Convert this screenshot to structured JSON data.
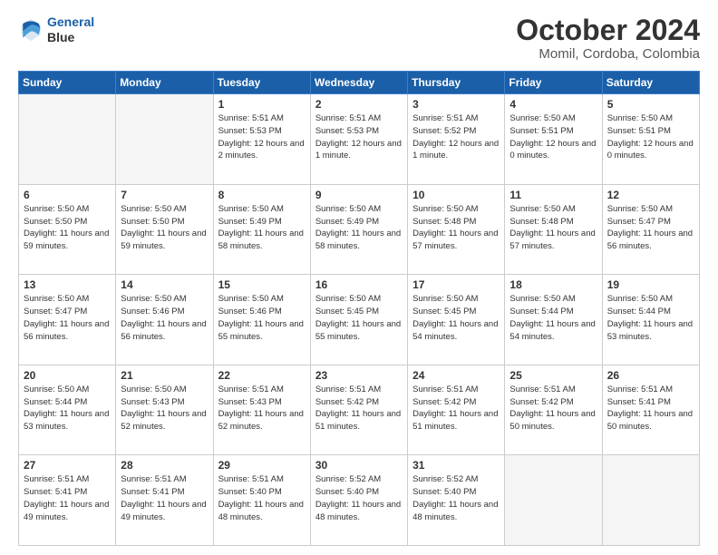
{
  "header": {
    "logo_line1": "General",
    "logo_line2": "Blue",
    "month": "October 2024",
    "location": "Momil, Cordoba, Colombia"
  },
  "weekdays": [
    "Sunday",
    "Monday",
    "Tuesday",
    "Wednesday",
    "Thursday",
    "Friday",
    "Saturday"
  ],
  "weeks": [
    [
      {
        "day": "",
        "sunrise": "",
        "sunset": "",
        "daylight": ""
      },
      {
        "day": "",
        "sunrise": "",
        "sunset": "",
        "daylight": ""
      },
      {
        "day": "1",
        "sunrise": "Sunrise: 5:51 AM",
        "sunset": "Sunset: 5:53 PM",
        "daylight": "Daylight: 12 hours and 2 minutes."
      },
      {
        "day": "2",
        "sunrise": "Sunrise: 5:51 AM",
        "sunset": "Sunset: 5:53 PM",
        "daylight": "Daylight: 12 hours and 1 minute."
      },
      {
        "day": "3",
        "sunrise": "Sunrise: 5:51 AM",
        "sunset": "Sunset: 5:52 PM",
        "daylight": "Daylight: 12 hours and 1 minute."
      },
      {
        "day": "4",
        "sunrise": "Sunrise: 5:50 AM",
        "sunset": "Sunset: 5:51 PM",
        "daylight": "Daylight: 12 hours and 0 minutes."
      },
      {
        "day": "5",
        "sunrise": "Sunrise: 5:50 AM",
        "sunset": "Sunset: 5:51 PM",
        "daylight": "Daylight: 12 hours and 0 minutes."
      }
    ],
    [
      {
        "day": "6",
        "sunrise": "Sunrise: 5:50 AM",
        "sunset": "Sunset: 5:50 PM",
        "daylight": "Daylight: 11 hours and 59 minutes."
      },
      {
        "day": "7",
        "sunrise": "Sunrise: 5:50 AM",
        "sunset": "Sunset: 5:50 PM",
        "daylight": "Daylight: 11 hours and 59 minutes."
      },
      {
        "day": "8",
        "sunrise": "Sunrise: 5:50 AM",
        "sunset": "Sunset: 5:49 PM",
        "daylight": "Daylight: 11 hours and 58 minutes."
      },
      {
        "day": "9",
        "sunrise": "Sunrise: 5:50 AM",
        "sunset": "Sunset: 5:49 PM",
        "daylight": "Daylight: 11 hours and 58 minutes."
      },
      {
        "day": "10",
        "sunrise": "Sunrise: 5:50 AM",
        "sunset": "Sunset: 5:48 PM",
        "daylight": "Daylight: 11 hours and 57 minutes."
      },
      {
        "day": "11",
        "sunrise": "Sunrise: 5:50 AM",
        "sunset": "Sunset: 5:48 PM",
        "daylight": "Daylight: 11 hours and 57 minutes."
      },
      {
        "day": "12",
        "sunrise": "Sunrise: 5:50 AM",
        "sunset": "Sunset: 5:47 PM",
        "daylight": "Daylight: 11 hours and 56 minutes."
      }
    ],
    [
      {
        "day": "13",
        "sunrise": "Sunrise: 5:50 AM",
        "sunset": "Sunset: 5:47 PM",
        "daylight": "Daylight: 11 hours and 56 minutes."
      },
      {
        "day": "14",
        "sunrise": "Sunrise: 5:50 AM",
        "sunset": "Sunset: 5:46 PM",
        "daylight": "Daylight: 11 hours and 56 minutes."
      },
      {
        "day": "15",
        "sunrise": "Sunrise: 5:50 AM",
        "sunset": "Sunset: 5:46 PM",
        "daylight": "Daylight: 11 hours and 55 minutes."
      },
      {
        "day": "16",
        "sunrise": "Sunrise: 5:50 AM",
        "sunset": "Sunset: 5:45 PM",
        "daylight": "Daylight: 11 hours and 55 minutes."
      },
      {
        "day": "17",
        "sunrise": "Sunrise: 5:50 AM",
        "sunset": "Sunset: 5:45 PM",
        "daylight": "Daylight: 11 hours and 54 minutes."
      },
      {
        "day": "18",
        "sunrise": "Sunrise: 5:50 AM",
        "sunset": "Sunset: 5:44 PM",
        "daylight": "Daylight: 11 hours and 54 minutes."
      },
      {
        "day": "19",
        "sunrise": "Sunrise: 5:50 AM",
        "sunset": "Sunset: 5:44 PM",
        "daylight": "Daylight: 11 hours and 53 minutes."
      }
    ],
    [
      {
        "day": "20",
        "sunrise": "Sunrise: 5:50 AM",
        "sunset": "Sunset: 5:44 PM",
        "daylight": "Daylight: 11 hours and 53 minutes."
      },
      {
        "day": "21",
        "sunrise": "Sunrise: 5:50 AM",
        "sunset": "Sunset: 5:43 PM",
        "daylight": "Daylight: 11 hours and 52 minutes."
      },
      {
        "day": "22",
        "sunrise": "Sunrise: 5:51 AM",
        "sunset": "Sunset: 5:43 PM",
        "daylight": "Daylight: 11 hours and 52 minutes."
      },
      {
        "day": "23",
        "sunrise": "Sunrise: 5:51 AM",
        "sunset": "Sunset: 5:42 PM",
        "daylight": "Daylight: 11 hours and 51 minutes."
      },
      {
        "day": "24",
        "sunrise": "Sunrise: 5:51 AM",
        "sunset": "Sunset: 5:42 PM",
        "daylight": "Daylight: 11 hours and 51 minutes."
      },
      {
        "day": "25",
        "sunrise": "Sunrise: 5:51 AM",
        "sunset": "Sunset: 5:42 PM",
        "daylight": "Daylight: 11 hours and 50 minutes."
      },
      {
        "day": "26",
        "sunrise": "Sunrise: 5:51 AM",
        "sunset": "Sunset: 5:41 PM",
        "daylight": "Daylight: 11 hours and 50 minutes."
      }
    ],
    [
      {
        "day": "27",
        "sunrise": "Sunrise: 5:51 AM",
        "sunset": "Sunset: 5:41 PM",
        "daylight": "Daylight: 11 hours and 49 minutes."
      },
      {
        "day": "28",
        "sunrise": "Sunrise: 5:51 AM",
        "sunset": "Sunset: 5:41 PM",
        "daylight": "Daylight: 11 hours and 49 minutes."
      },
      {
        "day": "29",
        "sunrise": "Sunrise: 5:51 AM",
        "sunset": "Sunset: 5:40 PM",
        "daylight": "Daylight: 11 hours and 48 minutes."
      },
      {
        "day": "30",
        "sunrise": "Sunrise: 5:52 AM",
        "sunset": "Sunset: 5:40 PM",
        "daylight": "Daylight: 11 hours and 48 minutes."
      },
      {
        "day": "31",
        "sunrise": "Sunrise: 5:52 AM",
        "sunset": "Sunset: 5:40 PM",
        "daylight": "Daylight: 11 hours and 48 minutes."
      },
      {
        "day": "",
        "sunrise": "",
        "sunset": "",
        "daylight": ""
      },
      {
        "day": "",
        "sunrise": "",
        "sunset": "",
        "daylight": ""
      }
    ]
  ]
}
